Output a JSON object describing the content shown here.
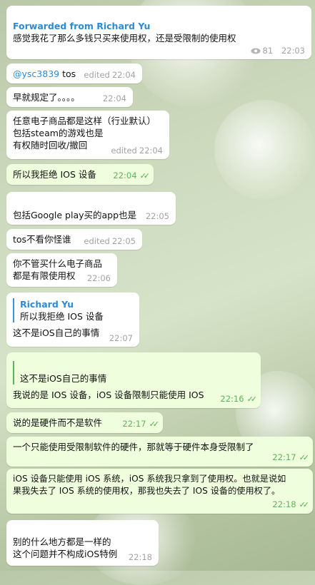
{
  "messages": [
    {
      "forward_title": "Forwarded from Richard Yu",
      "text": "感觉我花了那么多钱只买来使用权，还是受限制的使用权",
      "views": "81",
      "time": "22:03"
    },
    {
      "mention": "@ysc3839",
      "text": "tos",
      "edited": "edited",
      "time": "22:04"
    },
    {
      "text": "早就规定了。。。。",
      "time": "22:04"
    },
    {
      "lines": [
        "任意电子商品都是这样（行业默认）",
        "包括steam的游戏也是",
        "有权随时回收/撤回"
      ],
      "edited": "edited",
      "time": "22:04"
    },
    {
      "text": "所以我拒绝 IOS 设备",
      "time": "22:04"
    },
    {
      "text": "包括Google play买的app也是",
      "time": "22:05"
    },
    {
      "text": "tos不看你怪谁",
      "edited": "edited",
      "time": "22:05"
    },
    {
      "lines": [
        "你不管买什么电子商品",
        "都是有限使用权"
      ],
      "time": "22:06"
    },
    {
      "reply_name": "Richard Yu",
      "reply_text": "所以我拒绝 IOS 设备",
      "text": "这不是iOS自己的事情",
      "time": "22:07"
    },
    {
      "reply_text": "这不是iOS自己的事情",
      "text": "我说的是 IOS 设备，iOS 设备限制只能使用 IOS",
      "time": "22:16"
    },
    {
      "text": "说的是硬件而不是软件",
      "time": "22:17"
    },
    {
      "text": "一个只能使用受限制软件的硬件，那就等于硬件本身受限制了",
      "time": "22:17"
    },
    {
      "lines": [
        "iOS 设备只能使用 iOS 系统，iOS 系统我只拿到了使用权。也就是说如",
        "果我失去了 IOS 系统的使用权，那我也失去了 IOS 设备的使用权了。"
      ],
      "time": "22:18"
    },
    {
      "lines": [
        "别的什么地方都是一样的",
        "这个问题并不构成iOS特例"
      ],
      "time": "22:18"
    }
  ],
  "icons": {
    "views": "eye-icon",
    "read_receipt": "double-check-icon"
  },
  "colors": {
    "incoming_bubble": "#ffffff",
    "outgoing_bubble": "#effedd",
    "link_blue": "#2b8bd6",
    "check_green": "#4fae4e"
  }
}
